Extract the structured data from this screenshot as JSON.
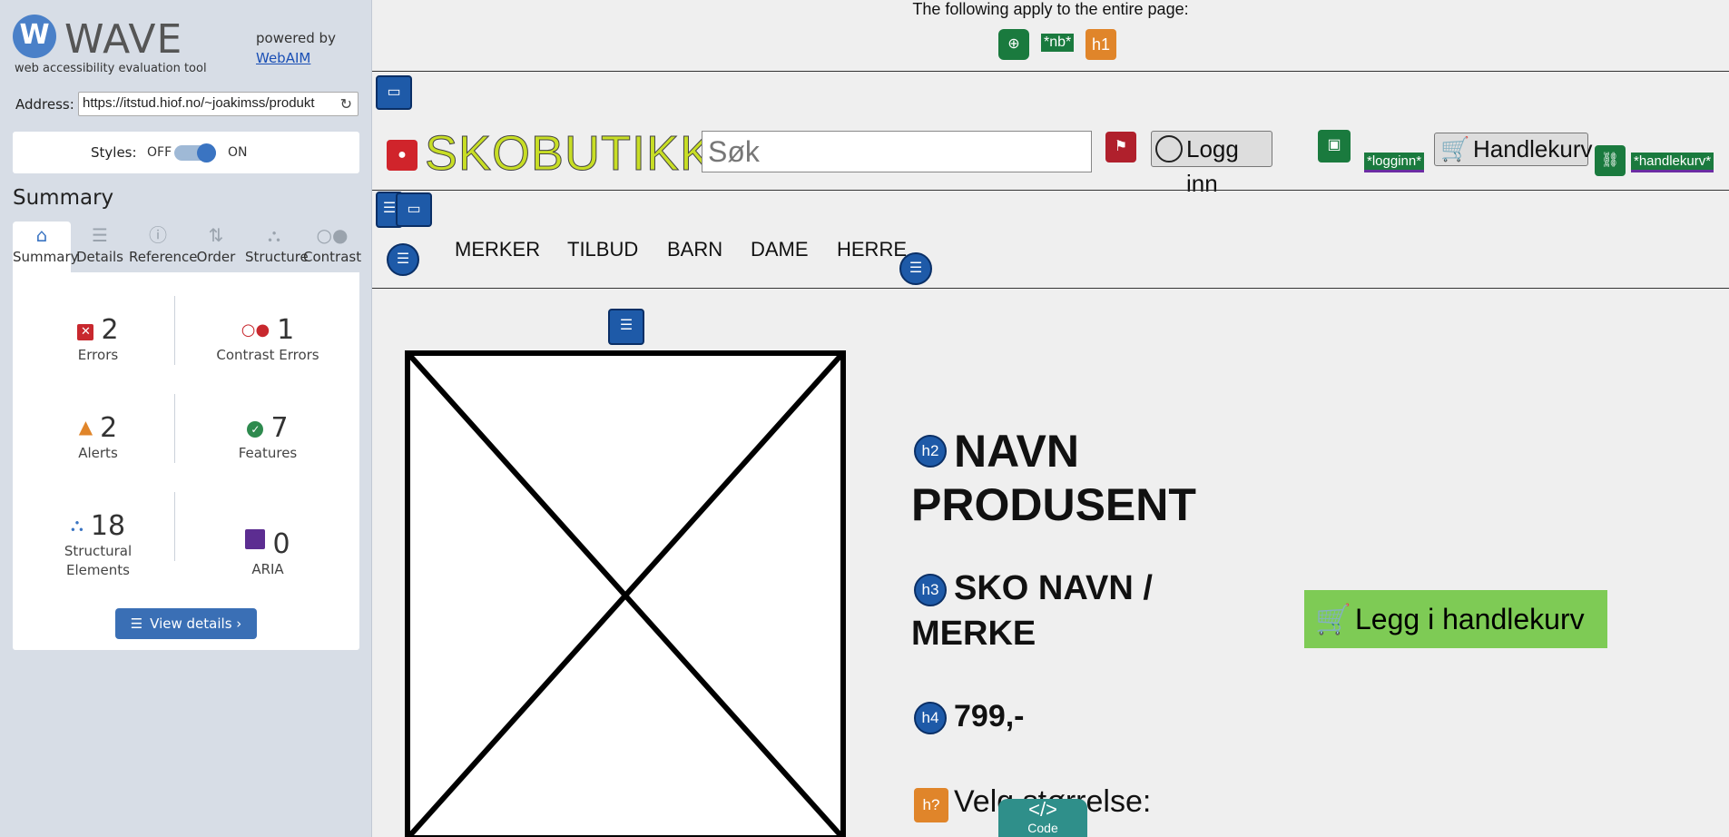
{
  "wave": {
    "logo_text": "WAVE",
    "logo_subtitle": "web accessibility evaluation tool",
    "powered_by": "powered by",
    "webaim_link": "WebAIM",
    "address_label": "Address:",
    "address_value": "https://itstud.hiof.no/~joakimss/produkt",
    "styles_label": "Styles:",
    "styles_off": "OFF",
    "styles_on": "ON",
    "summary_heading": "Summary",
    "tabs": [
      {
        "label": "Summary",
        "icon": "home-icon",
        "active": true
      },
      {
        "label": "Details",
        "icon": "list-icon",
        "active": false
      },
      {
        "label": "Reference",
        "icon": "info-icon",
        "active": false
      },
      {
        "label": "Order",
        "icon": "order-icon",
        "active": false
      },
      {
        "label": "Structure",
        "icon": "structure-icon",
        "active": false
      },
      {
        "label": "Contrast",
        "icon": "contrast-icon",
        "active": false
      }
    ],
    "stats": {
      "errors": {
        "count": "2",
        "label": "Errors",
        "color": "#c8282e"
      },
      "contrast_errors": {
        "count": "1",
        "label": "Contrast Errors",
        "color": "#c8282e"
      },
      "alerts": {
        "count": "2",
        "label": "Alerts",
        "color": "#e0852a"
      },
      "features": {
        "count": "7",
        "label": "Features",
        "color": "#2e8a4e"
      },
      "structural": {
        "count": "18",
        "label_line1": "Structural",
        "label_line2": "Elements",
        "color": "#3a74c2"
      },
      "aria": {
        "count": "0",
        "label": "ARIA",
        "color": "#5c2d91"
      }
    },
    "view_details": "View details ›"
  },
  "page": {
    "apply_text": "The following apply to the entire page:",
    "lang_tag": "*nb*",
    "h1_badge": "h1",
    "brand": "SKOBUTIKK",
    "search_placeholder": "Søk",
    "login_label": "Logg inn",
    "login_tag": "*logginn*",
    "cart_label": "Handlekurv",
    "cart_tag": "*handlekurv*",
    "nav": [
      "MERKER",
      "TILBUD",
      "BARN",
      "DAME",
      "HERRE"
    ],
    "h2_badge": "h2",
    "h2_line1": "NAVN",
    "h2_line2": "PRODUSENT",
    "h3_badge": "h3",
    "h3_line1": "SKO NAVN /",
    "h3_line2": "MERKE",
    "h4_badge": "h4",
    "price": "799,-",
    "hq_badge": "h?",
    "size_label": "Velg størrelse:",
    "buy_button": "Legg i handlekurv",
    "code_tab": "Code",
    "code_symbol": "</>"
  }
}
